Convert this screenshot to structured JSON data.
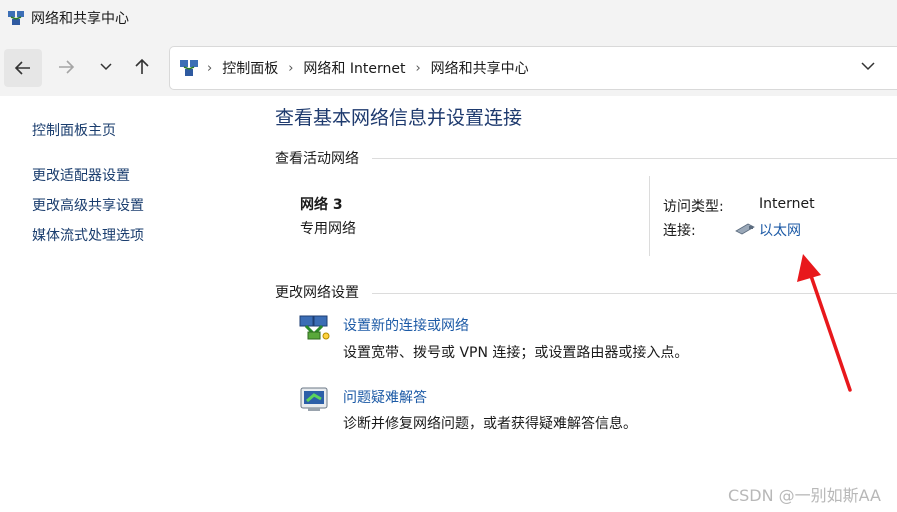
{
  "window": {
    "title": "网络和共享中心"
  },
  "nav": {
    "breadcrumb": [
      "控制面板",
      "网络和 Internet",
      "网络和共享中心"
    ]
  },
  "sidebar": {
    "items": [
      {
        "label": "控制面板主页"
      },
      {
        "label": "更改适配器设置"
      },
      {
        "label": "更改高级共享设置"
      },
      {
        "label": "媒体流式处理选项"
      }
    ]
  },
  "main": {
    "title": "查看基本网络信息并设置连接",
    "active_section": "查看活动网络",
    "network": {
      "name": "网络 3",
      "category": "专用网络",
      "access_type_label": "访问类型:",
      "access_type_value": "Internet",
      "connection_label": "连接:",
      "connection_value": "以太网"
    },
    "change_section": "更改网络设置",
    "tasks": [
      {
        "link": "设置新的连接或网络",
        "desc": "设置宽带、拨号或 VPN 连接；或设置路由器或接入点。",
        "icon": "new-connection-icon"
      },
      {
        "link": "问题疑难解答",
        "desc": "诊断并修复网络问题，或者获得疑难解答信息。",
        "icon": "troubleshoot-icon"
      }
    ]
  },
  "annotation": {
    "arrow_color": "#e8181c"
  },
  "watermark": "CSDN @一别如斯AA"
}
